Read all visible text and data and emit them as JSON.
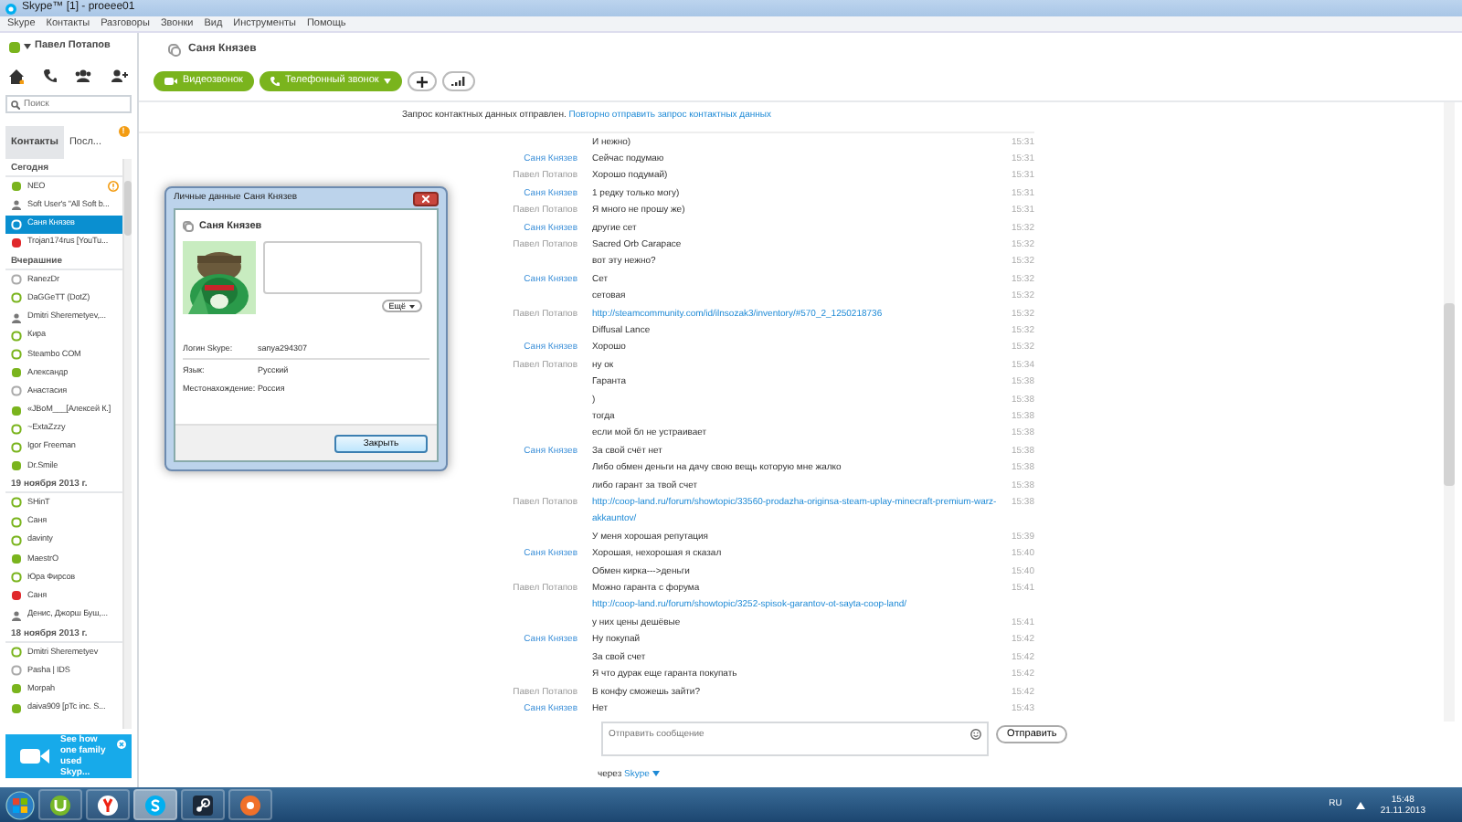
{
  "window": {
    "title": "Skype™ [1] - proeee01"
  },
  "menu": [
    "Skype",
    "Контакты",
    "Разговоры",
    "Звонки",
    "Вид",
    "Инструменты",
    "Помощь"
  ],
  "profile": {
    "name": "Павел Потапов",
    "kind": "online"
  },
  "search": {
    "placeholder": "Поиск"
  },
  "sidebar_tabs": [
    {
      "label": "Контакты",
      "selected": true
    },
    {
      "label": "Посл...",
      "selected": false,
      "badge": "!"
    }
  ],
  "contact_groups": [
    {
      "title": "Сегодня",
      "contacts": [
        {
          "name": "NEO",
          "kind": "online",
          "alert": true,
          "selected": false
        },
        {
          "name": "Soft User's \"All Soft b...",
          "kind": "group",
          "alert": false,
          "selected": false
        },
        {
          "name": "Саня Князев",
          "kind": "idle",
          "alert": false,
          "selected": true
        },
        {
          "name": "Trojan174rus [YouTu...",
          "kind": "busy",
          "alert": false,
          "selected": false
        }
      ]
    },
    {
      "title": "Вчерашние",
      "contacts": [
        {
          "name": "RanezDr",
          "kind": "offline",
          "alert": false,
          "selected": false
        },
        {
          "name": "DaGGeTT (DotZ)",
          "kind": "idle",
          "alert": false,
          "selected": false
        },
        {
          "name": "Dmitri Sheremetyev,...",
          "kind": "group",
          "alert": false,
          "selected": false
        },
        {
          "name": "Кира",
          "kind": "idle",
          "alert": false,
          "selected": false
        },
        {
          "name": "Steambo COM",
          "kind": "idle",
          "alert": false,
          "selected": false
        },
        {
          "name": "Александр",
          "kind": "online",
          "alert": false,
          "selected": false
        },
        {
          "name": "Анастасия",
          "kind": "offline",
          "alert": false,
          "selected": false
        },
        {
          "name": "«JBoM___[Алексей К.]",
          "kind": "online",
          "alert": false,
          "selected": false
        },
        {
          "name": "~ExtaZzzy",
          "kind": "idle",
          "alert": false,
          "selected": false
        },
        {
          "name": "Igor Freeman",
          "kind": "idle",
          "alert": false,
          "selected": false
        },
        {
          "name": "Dr.Smile",
          "kind": "online",
          "alert": false,
          "selected": false
        }
      ]
    },
    {
      "title": "19 ноября 2013 г.",
      "contacts": [
        {
          "name": "SHinT",
          "kind": "idle",
          "alert": false,
          "selected": false
        },
        {
          "name": "Саня",
          "kind": "idle",
          "alert": false,
          "selected": false
        },
        {
          "name": "davinty",
          "kind": "idle",
          "alert": false,
          "selected": false
        },
        {
          "name": "MaestrO",
          "kind": "online",
          "alert": false,
          "selected": false
        },
        {
          "name": "Юра Фирсов",
          "kind": "idle",
          "alert": false,
          "selected": false
        },
        {
          "name": "Саня",
          "kind": "busy",
          "alert": false,
          "selected": false
        },
        {
          "name": "Денис, Джорш Буш,...",
          "kind": "group",
          "alert": false,
          "selected": false
        }
      ]
    },
    {
      "title": "18 ноября 2013 г.",
      "contacts": [
        {
          "name": "Dmitri Sheremetyev",
          "kind": "idle",
          "alert": false,
          "selected": false
        },
        {
          "name": "Pasha | IDS",
          "kind": "offline",
          "alert": false,
          "selected": false
        },
        {
          "name": "Morpah",
          "kind": "online",
          "alert": false,
          "selected": false
        },
        {
          "name": "daiva909 [pTc inc. S...",
          "kind": "online",
          "alert": false,
          "selected": false
        }
      ]
    }
  ],
  "ad": {
    "text": "See how one family used Skyp..."
  },
  "chat": {
    "title": "Саня Князев",
    "buttons": [
      {
        "label": "Видеозвонок",
        "kind": "video"
      },
      {
        "label": "Телефонный звонок",
        "kind": "phone"
      }
    ],
    "notice": "Запрос контактных данных отправлен.",
    "notice_link": "Повторно отправить запрос контактных данных",
    "messages": [
      {
        "text": "И нежно)",
        "time": "15:31"
      },
      {
        "sender": "Саня Князев",
        "kind": "contact",
        "text": "Сейчас подумаю",
        "time": "15:31"
      },
      {
        "sender": "Павел Потапов",
        "kind": "self",
        "text": "Хорошо подумай)",
        "time": "15:31"
      },
      {
        "sender": "Саня Князев",
        "kind": "contact",
        "text": "1 редку только могу)",
        "time": "15:31"
      },
      {
        "sender": "Павел Потапов",
        "kind": "self",
        "text": "Я много не прошу же)",
        "time": "15:31"
      },
      {
        "sender": "Саня Князев",
        "kind": "contact",
        "text": "другие сет",
        "time": "15:32"
      },
      {
        "sender": "Павел Потапов",
        "kind": "self",
        "text": "Sacred Orb Carapace",
        "time": "15:32"
      },
      {
        "text": "вот эту нежно?",
        "time": "15:32"
      },
      {
        "sender": "Саня Князев",
        "kind": "contact",
        "text": "Сет",
        "time": "15:32"
      },
      {
        "text": "сетовая",
        "time": "15:32"
      },
      {
        "sender": "Павел Потапов",
        "kind": "self",
        "link": "http://steamcommunity.com/id/ilnsozak3/inventory/#570_2_1250218736",
        "time": "15:32"
      },
      {
        "text": "Diffusal Lance",
        "time": "15:32"
      },
      {
        "sender": "Саня Князев",
        "kind": "contact",
        "text": "Хорошо",
        "time": "15:32"
      },
      {
        "sender": "Павел Потапов",
        "kind": "self",
        "text": "ну ок",
        "time": "15:34"
      },
      {
        "text": "Гаранта",
        "time": "15:38"
      },
      {
        "text": ")",
        "time": "15:38"
      },
      {
        "text": "тогда",
        "time": "15:38"
      },
      {
        "text": "если мой бл не устраивает",
        "time": "15:38"
      },
      {
        "sender": "Саня Князев",
        "kind": "contact",
        "text": "За свой счёт нет",
        "time": "15:38"
      },
      {
        "text": "Либо обмен деньги на дачу свою вещь которую мне жалко",
        "time": "15:38"
      },
      {
        "text": "либо гарант за твой счет",
        "time": "15:38"
      },
      {
        "sender": "Павел Потапов",
        "kind": "self",
        "link": "http://coop-land.ru/forum/showtopic/33560-prodazha-originsa-steam-uplay-minecraft-premium-warz-akkauntov/",
        "time": "15:38"
      },
      {
        "text": "У меня хорошая репутация",
        "time": "15:39"
      },
      {
        "sender": "Саня Князев",
        "kind": "contact",
        "text": "Хорошая, нехорошая я сказал",
        "time": "15:40"
      },
      {
        "text": "Обмен кирка--->деньги",
        "time": "15:40"
      },
      {
        "sender": "Павел Потапов",
        "kind": "self",
        "text": "Можно гаранта с форума",
        "link": "http://coop-land.ru/forum/showtopic/3252-spisok-garantov-ot-sayta-coop-land/",
        "time": "15:41"
      },
      {
        "text": "у них цены дешёвые",
        "time": "15:41"
      },
      {
        "sender": "Саня Князев",
        "kind": "contact",
        "text": "Ну покупай",
        "time": "15:42"
      },
      {
        "text": "За свой счет",
        "time": "15:42"
      },
      {
        "text": "Я что дурак еще гаранта покупать",
        "time": "15:42"
      },
      {
        "sender": "Павел Потапов",
        "kind": "self",
        "text": "В конфу сможешь зайти?",
        "time": "15:42"
      },
      {
        "sender": "Саня Князев",
        "kind": "contact",
        "text": "Нет",
        "time": "15:43"
      }
    ],
    "input": {
      "placeholder": "Отправить сообщение"
    },
    "send_button": "Отправить",
    "via": "через",
    "via_link": "Skype"
  },
  "dialog": {
    "title": "Личные данные Саня Князев",
    "name": "Саня Князев",
    "more_button": "Ещё",
    "fields": [
      {
        "label": "Логин Skype:",
        "value": "sanya294307"
      },
      {
        "label": "Язык:",
        "value": "Русский"
      },
      {
        "label": "Местонахождение:",
        "value": "Россия"
      }
    ],
    "close_button": "Закрыть"
  },
  "taskbar": {
    "apps": [
      {
        "kind": "torrent",
        "selected": false
      },
      {
        "kind": "browser",
        "selected": false
      },
      {
        "kind": "skype",
        "selected": true
      },
      {
        "kind": "steam",
        "selected": false
      },
      {
        "kind": "media",
        "selected": false
      }
    ],
    "language": "RU",
    "time": "15:48",
    "date": "21.11.2013"
  }
}
